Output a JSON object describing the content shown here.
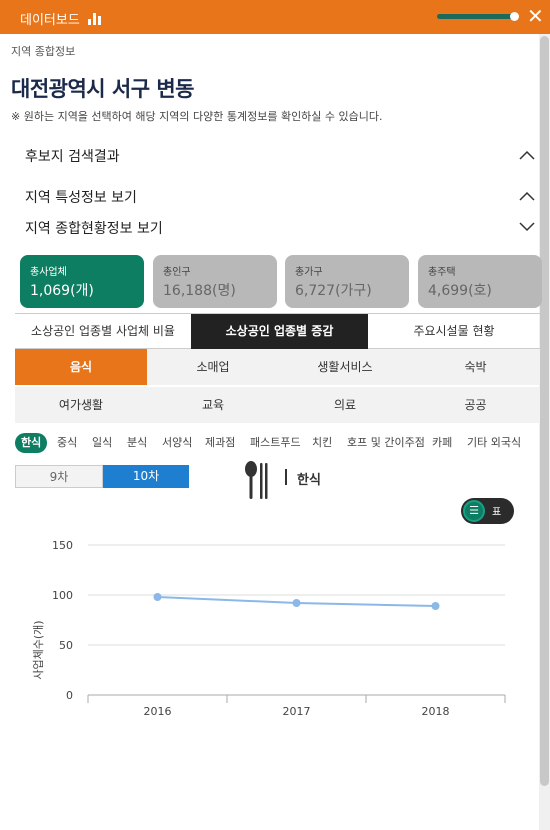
{
  "topbar": {
    "title": "데이터보드",
    "close": "✕"
  },
  "breadcrumb": "지역 종합정보",
  "page_title": "대전광역시 서구 변동",
  "note": "※ 원하는 지역을 선택하여 해당 지역의 다양한 통계정보를 확인하실 수 있습니다.",
  "sections": {
    "candidate": "후보지 검색결과",
    "feature": "지역 특성정보 보기",
    "summary": "지역 종합현황정보 보기"
  },
  "stats": [
    {
      "label": "총사업체",
      "value": "1,069(개)"
    },
    {
      "label": "총인구",
      "value": "16,188(명)"
    },
    {
      "label": "총가구",
      "value": "6,727(가구)"
    },
    {
      "label": "총주택",
      "value": "4,699(호)"
    }
  ],
  "tabs": [
    "소상공인 업종별 사업체 비율",
    "소상공인 업종별 증감",
    "주요시설물 현황"
  ],
  "categories_row1": [
    "음식",
    "소매업",
    "생활서비스",
    "숙박"
  ],
  "categories_row2": [
    "여가생활",
    "교육",
    "의료",
    "공공"
  ],
  "subcategories": [
    "한식",
    "중식",
    "일식",
    "분식",
    "서양식",
    "제과점",
    "패스트푸드",
    "치킨",
    "호프 및 간이주점",
    "카페",
    "기타 외국식"
  ],
  "segment": {
    "off": "9차",
    "on": "10차"
  },
  "food_label": "한식",
  "toggle": {
    "on": "☰",
    "off": "표"
  },
  "colors": {
    "brand": "#E8751A",
    "accent": "#0E7E63",
    "line": "#8BB8E8",
    "blue": "#1E7FD0"
  },
  "chart_data": {
    "type": "line",
    "x": [
      "2016",
      "2017",
      "2018"
    ],
    "series": [
      {
        "values": [
          98,
          92,
          89
        ]
      }
    ],
    "ylabel": "사업체수(개)",
    "ylim": [
      0,
      150
    ],
    "yticks": [
      0,
      50,
      100,
      150
    ],
    "grid": true
  }
}
